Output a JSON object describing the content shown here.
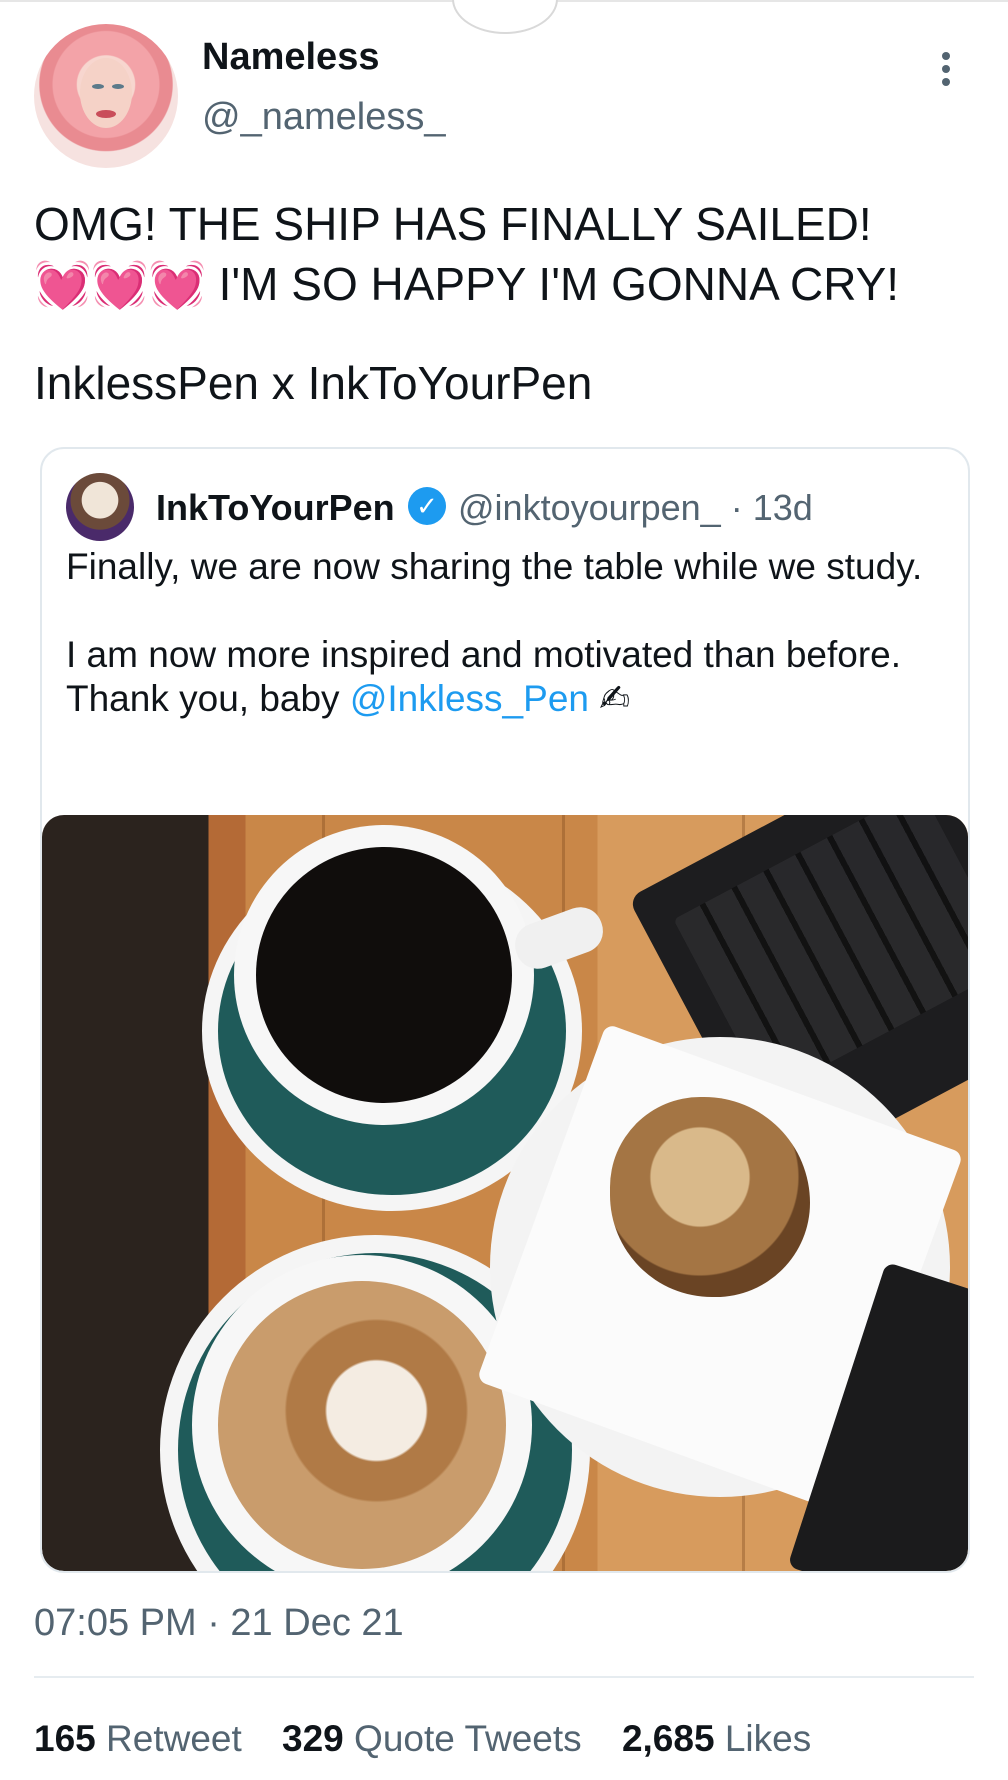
{
  "tweet": {
    "author_name": "Nameless",
    "author_handle": "@_nameless_",
    "text_line1": "OMG! THE SHIP HAS FINALLY SAILED!",
    "hearts": "💓💓💓",
    "text_line2_rest": " I'M SO HAPPY I'M GONNA CRY!",
    "ship": "InklessPen x InkToYourPen",
    "timestamp": "07:05 PM · 21 Dec 21"
  },
  "quote": {
    "author_name": "InkToYourPen",
    "verified_mark": "✓",
    "handle_time": "@inktoyourpen_ · 13d",
    "para1": "Finally, we are now sharing the table while we study.",
    "para2_start": "I am now more inspired and motivated than before. Thank you, baby ",
    "mention": "@Inkless_Pen",
    "emoji": " ✍"
  },
  "stats": {
    "retweets_count": "165",
    "retweets_label": "Retweet",
    "quotes_count": "329",
    "quotes_label": "Quote Tweets",
    "likes_count": "2,685",
    "likes_label": "Likes"
  },
  "colors": {
    "accent": "#1d9bf0",
    "secondary_text": "#536471",
    "primary_text": "#0f1419"
  },
  "icons": {
    "more": "more-vertical-icon",
    "verified": "verified-badge-icon"
  }
}
